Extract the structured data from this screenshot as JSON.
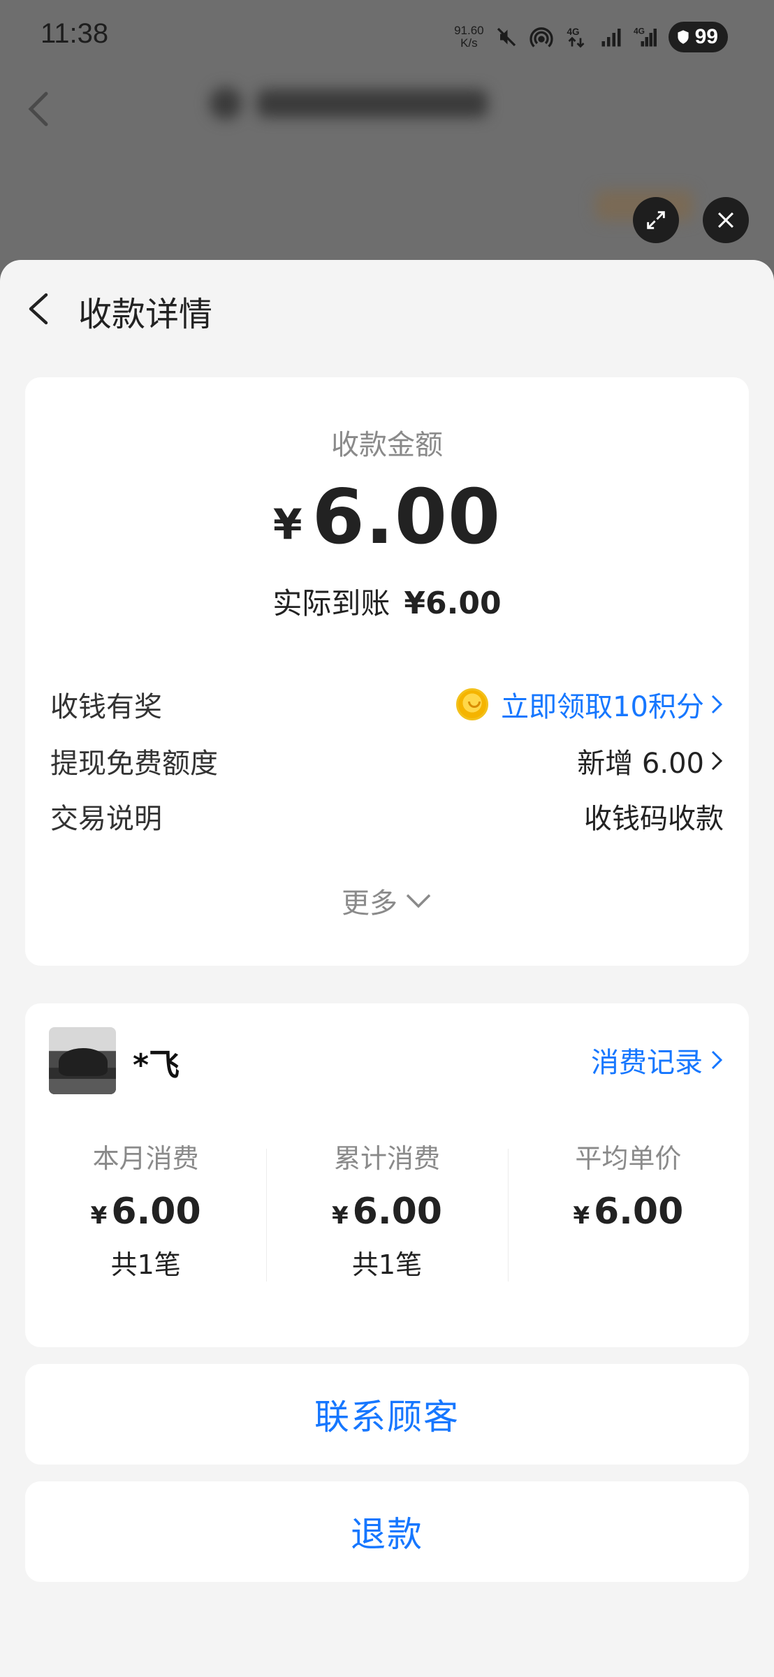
{
  "status_bar": {
    "time": "11:38",
    "net_speed_value": "91.60",
    "net_speed_unit": "K/s",
    "battery": "99",
    "icons": [
      "mute-icon",
      "hotspot-icon",
      "4g-data-icon",
      "signal-icon",
      "4g-signal-icon",
      "battery-icon"
    ]
  },
  "background": {
    "controls": [
      "expand-icon",
      "close-icon"
    ]
  },
  "header": {
    "title": "收款详情"
  },
  "amount_card": {
    "label": "收款金额",
    "currency": "¥",
    "amount": "6.00",
    "actual_label": "实际到账",
    "actual_value": "¥6.00",
    "rows": [
      {
        "label": "收钱有奖",
        "value": "立即领取10积分"
      },
      {
        "label": "提现免费额度",
        "value": "新增 6.00"
      },
      {
        "label": "交易说明",
        "value": "收钱码收款"
      }
    ],
    "more_label": "更多"
  },
  "customer_card": {
    "name": "*飞",
    "record_link": "消费记录",
    "stats": [
      {
        "label": "本月消费",
        "currency": "¥",
        "value": "6.00",
        "count": "共1笔"
      },
      {
        "label": "累计消费",
        "currency": "¥",
        "value": "6.00",
        "count": "共1笔"
      },
      {
        "label": "平均单价",
        "currency": "¥",
        "value": "6.00",
        "count": ""
      }
    ]
  },
  "actions": {
    "contact": "联系顾客",
    "refund": "退款"
  },
  "colors": {
    "accent": "#1677ff",
    "sheet_background": "#f4f4f4",
    "card": "#ffffff",
    "overlay": "#6e6e6e"
  }
}
